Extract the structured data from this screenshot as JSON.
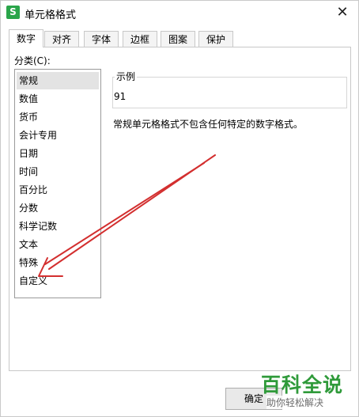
{
  "window": {
    "title": "单元格格式",
    "app_icon_letter": "S"
  },
  "tabs": [
    {
      "label": "数字",
      "active": true
    },
    {
      "label": "对齐",
      "active": false
    },
    {
      "label": "字体",
      "active": false
    },
    {
      "label": "边框",
      "active": false
    },
    {
      "label": "图案",
      "active": false
    },
    {
      "label": "保护",
      "active": false
    }
  ],
  "category": {
    "label": "分类(C):",
    "items": [
      "常规",
      "数值",
      "货币",
      "会计专用",
      "日期",
      "时间",
      "百分比",
      "分数",
      "科学记数",
      "文本",
      "特殊",
      "自定义"
    ],
    "selected": "常规"
  },
  "sample": {
    "legend": "示例",
    "value": "91"
  },
  "description": "常规单元格格式不包含任何特定的数字格式。",
  "buttons": {
    "ok": "确定"
  },
  "watermark": {
    "title": "百科全说",
    "subtitle": "助你轻松解决"
  },
  "colors": {
    "arrow": "#d32f2f",
    "watermark": "#2f9a3a",
    "app_icon": "#2aa54a"
  }
}
